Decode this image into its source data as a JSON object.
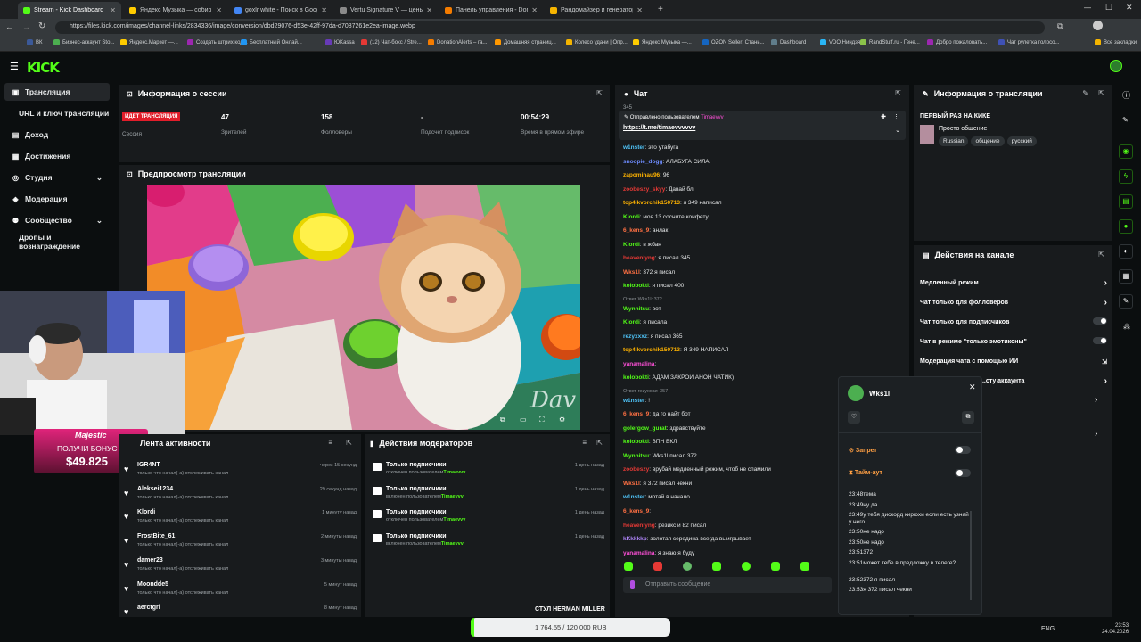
{
  "browser": {
    "tabs": [
      {
        "label": "Stream - Kick Dashboard",
        "color": "#53fc18",
        "active": true
      },
      {
        "label": "Яндекс Музыка — собир",
        "color": "#ffcc00"
      },
      {
        "label": "goxlr white - Поиск в Google",
        "color": "#4285f4"
      },
      {
        "label": "Vertu Signature V — цены, ку",
        "color": "#8a8a8a"
      },
      {
        "label": "Панель управления - Donatio",
        "color": "#f57c00"
      },
      {
        "label": "Рандомайзер и генератор сл",
        "color": "#f5b400"
      }
    ],
    "new_tab": "+",
    "url": "https://files.kick.com/images/channel-links/2834336/image/conversion/dbd29076-d53e-42ff-97da-d7087261e2ea-image.webp",
    "bookmarks": [
      "ВК",
      "Бизнес-аккаунт Sto...",
      "Яндекс.Маркет —...",
      "Создать штрих код...",
      "Бесплатный Онлай...",
      "ЮKassa",
      "(12) Чат-бокс / Stre...",
      "DonationAlerts – га...",
      "Домашняя страниц...",
      "Колесо удачи | Опр...",
      "Яндекс Музыка —...",
      "OZON Seller: Стань...",
      "Dashboard",
      "VDO.Ниндзя",
      "RandStuff.ru - Гене...",
      "Добро пожаловать...",
      "Чат рулетка голосо...",
      "Все закладки"
    ]
  },
  "kick": {
    "logo": "KICK"
  },
  "sidebar": {
    "items": [
      {
        "label": "Трансляция",
        "icon": "broadcast-icon"
      },
      {
        "label": "URL и ключ трансляции",
        "icon": ""
      },
      {
        "label": "Доход",
        "icon": "wallet-icon"
      },
      {
        "label": "Достижения",
        "icon": "trophy-icon"
      },
      {
        "label": "Студия",
        "icon": "studio-icon"
      },
      {
        "label": "Модерация",
        "icon": "shield-icon"
      },
      {
        "label": "Сообщество",
        "icon": "community-icon"
      },
      {
        "label": "Дропы и вознаграждение",
        "icon": ""
      }
    ]
  },
  "session": {
    "title": "Информация о сессии",
    "live_badge": "ИДЕТ ТРАНСЛЯЦИЯ",
    "session_label": "Сессия",
    "stats": [
      {
        "value": "47",
        "label": "Зрителей"
      },
      {
        "value": "158",
        "label": "Фолловеры"
      },
      {
        "value": "-",
        "label": "Подсчет подписок"
      },
      {
        "value": "00:54:29",
        "label": "Время в прямом эфире"
      }
    ]
  },
  "preview": {
    "title": "Предпросмотр трансляции",
    "watermark": "Dav"
  },
  "webcam": {
    "sponsor": "Majestic",
    "bonus_text": "ПОЛУЧИ БОНУС",
    "bonus_amount": "$49.825"
  },
  "activity": {
    "title": "Лента активности",
    "rows": [
      {
        "name": "IGR4NT",
        "sub": "только что начал(-а) отслеживать канал",
        "time": "через 15 секунд"
      },
      {
        "name": "Aleksei1234",
        "sub": "только что начал(-а) отслеживать канал",
        "time": "29 секунд назад"
      },
      {
        "name": "Klordi",
        "sub": "только что начал(-а) отслеживать канал",
        "time": "1 минуту назад"
      },
      {
        "name": "FrostBite_61",
        "sub": "только что начал(-а) отслеживать канал",
        "time": "2 минуты назад"
      },
      {
        "name": "damer23",
        "sub": "только что начал(-а) отслеживать канал",
        "time": "3 минуты назад"
      },
      {
        "name": "Moondde5",
        "sub": "только что начал(-а) отслеживать канал",
        "time": "5 минут назад"
      },
      {
        "name": "aerctgrl",
        "sub": "",
        "time": "8 минут назад"
      }
    ]
  },
  "mod_actions": {
    "title": "Действия модераторов",
    "rows": [
      {
        "name": "Только подписчики",
        "sub_prefix": "отключен пользователем",
        "user": "Timaevvv",
        "time": "1 день назад"
      },
      {
        "name": "Только подписчики",
        "sub_prefix": "включен пользователем",
        "user": "Timaevvv",
        "time": "1 день назад"
      },
      {
        "name": "Только подписчики",
        "sub_prefix": "отключен пользователем",
        "user": "Timaevvv",
        "time": "1 день назад"
      },
      {
        "name": "Только подписчики",
        "sub_prefix": "включен пользователем",
        "user": "Timaevvv",
        "time": "1 день назад"
      }
    ],
    "overlay_text": "СТУЛ HERMAN MILLER"
  },
  "chat": {
    "title": "Чат",
    "pinned_by": "Отправлено пользователем",
    "pinned_user": "Timaevvv",
    "pinned_link": "https://t.me/timaevvvvvv",
    "partial_top": "345",
    "messages": [
      {
        "user": "w1nster",
        "color": "#4fc3f7",
        "text": "это утабуга"
      },
      {
        "user": "snoopie_dogg",
        "color": "#6e8cff",
        "text": "АЛАБУГА СИЛА"
      },
      {
        "user": "zapominau96",
        "color": "#ffb300",
        "text": "96"
      },
      {
        "user": "zoobeszy_skyy",
        "color": "#e53935",
        "text": "Давай бл"
      },
      {
        "user": "top4ikvorchik150713",
        "color": "#ffb300",
        "text": "я 349 написал"
      },
      {
        "user": "Klordi",
        "color": "#53fc18",
        "text": "моя 13 сосните конфету"
      },
      {
        "user": "6_kens_9",
        "color": "#ff7043",
        "text": "анлак"
      },
      {
        "user": "Klordi",
        "color": "#53fc18",
        "text": "в жбан"
      },
      {
        "user": "heavenlyng",
        "color": "#e53935",
        "text": "я писал 345"
      },
      {
        "user": "Wks1l",
        "color": "#ff7043",
        "text": "372 я писал"
      },
      {
        "user": "kolobokti",
        "color": "#53fc18",
        "text": "я писал 400"
      },
      {
        "user": "Wynnitsu",
        "color": "#53fc18",
        "text": "вот",
        "reply": "Ответ Wks1l: 372"
      },
      {
        "user": "Klordi",
        "color": "#53fc18",
        "text": "я писала"
      },
      {
        "user": "rezyxxxz",
        "color": "#4fc3f7",
        "text": "я писал 365"
      },
      {
        "user": "top4ikvorchik150713",
        "color": "#ffb300",
        "text": "Я 349 НАПИСАЛ"
      },
      {
        "user": "yanamalina",
        "color": "#ff4fd8",
        "text": ""
      },
      {
        "user": "kolobokti",
        "color": "#53fc18",
        "text": "АДАМ ЗАКРОЙ АНОН ЧАТИК)"
      },
      {
        "user": "w1nster",
        "color": "#4fc3f7",
        "text": "!",
        "reply": "Ответ rezyxxxz: 357"
      },
      {
        "user": "6_kens_9",
        "color": "#ff7043",
        "text": "да го найт бот"
      },
      {
        "user": "golergow_gurat",
        "color": "#53fc18",
        "text": "здравствуйте"
      },
      {
        "user": "kolobokti",
        "color": "#53fc18",
        "text": "ВПН ВКЛ"
      },
      {
        "user": "Wynnitsu",
        "color": "#53fc18",
        "text": "Wks1l писал 372"
      },
      {
        "user": "zoobeszy",
        "color": "#e53935",
        "text": "врубай медленный режим, чтоб не спамили"
      },
      {
        "user": "Wks1l",
        "color": "#ff7043",
        "text": "я 372 писал чекни"
      },
      {
        "user": "w1nster",
        "color": "#4fc3f7",
        "text": "мотай в начало"
      },
      {
        "user": "6_kens_9",
        "color": "#ff7043",
        "text": ""
      },
      {
        "user": "heavenlyng",
        "color": "#e53935",
        "text": "резикс и 82 писал"
      },
      {
        "user": "kKkkkkp",
        "color": "#b388ff",
        "text": "золотая середина всегда выигрывает"
      },
      {
        "user": "yanamalina",
        "color": "#ff4fd8",
        "text": "я знаю я буду"
      }
    ],
    "input_placeholder": "Отправить сообщение"
  },
  "stream_info": {
    "title": "Информация о трансляции",
    "stream_title": "ПЕРВЫЙ РАЗ НА КИКЕ",
    "category": "Просто общение",
    "tags": [
      "Russian",
      "общение",
      "русский"
    ]
  },
  "channel_actions": {
    "title": "Действия на канале",
    "rows": [
      {
        "label": "Медленный режим",
        "kind": "chevron"
      },
      {
        "label": "Чат только для фолловеров",
        "kind": "chevron"
      },
      {
        "label": "Чат только для подписчиков",
        "kind": "toggle"
      },
      {
        "label": "Чат в режиме \"только эмотиконы\"",
        "kind": "toggle"
      },
      {
        "label": "Модерация чата с помощью ИИ",
        "kind": "external"
      },
      {
        "label": "...сту аккаунта",
        "kind": "chevron"
      }
    ]
  },
  "user_card": {
    "username": "Wks1l",
    "ban_label": "Запрет",
    "timeout_label": "Тайм-аут",
    "history": [
      {
        "time": "23:48",
        "text": "тема"
      },
      {
        "time": "23:49",
        "text": "ну да"
      },
      {
        "time": "23:49",
        "text": "у тебя дискорд кирюхи если есть узнай у него"
      },
      {
        "time": "23:50",
        "text": "не надо"
      },
      {
        "time": "23:50",
        "text": "не надо"
      },
      {
        "time": "23:51",
        "text": "372"
      },
      {
        "time": "23:51",
        "text": "может тебе в предложку в телеге?"
      },
      {
        "time": "23:52",
        "text": "372 я писал"
      },
      {
        "time": "23:53",
        "text": "я 372 писал чекни"
      }
    ]
  },
  "donation_bar": {
    "text": "1 764.55 / 120 000 RUB"
  },
  "taskbar": {
    "lang": "ENG",
    "time": "23:53",
    "date": "24.04.2026"
  },
  "colors": {
    "accent": "#53fc18",
    "live": "#e11d2a",
    "panel": "#181b1d",
    "bg": "#0b0e0f"
  }
}
